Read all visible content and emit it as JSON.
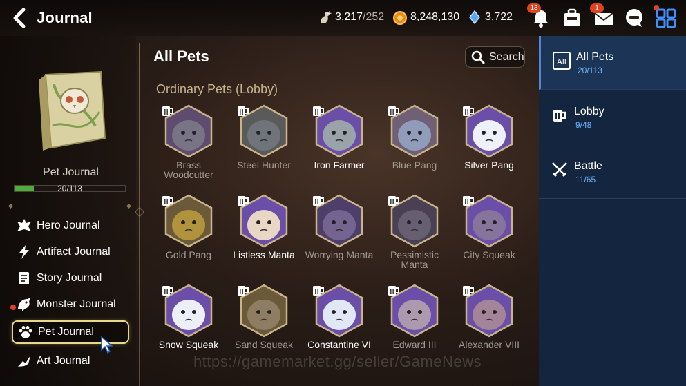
{
  "header": {
    "title": "Journal",
    "resources": [
      {
        "icon": "stamina-icon",
        "value": "3,217",
        "sub": "/252"
      },
      {
        "icon": "gold-icon",
        "value": "8,248,130",
        "sub": ""
      },
      {
        "icon": "crystal-icon",
        "value": "3,722",
        "sub": ""
      }
    ],
    "notification_count": "13",
    "mail_count": "1"
  },
  "left": {
    "journal_title": "Pet Journal",
    "progress_text": "20/113",
    "progress_fraction": 0.177,
    "nav": [
      {
        "label": "Hero Journal",
        "icon": "hero-icon"
      },
      {
        "label": "Artifact Journal",
        "icon": "artifact-icon"
      },
      {
        "label": "Story Journal",
        "icon": "story-icon"
      },
      {
        "label": "Monster Journal",
        "icon": "monster-icon"
      },
      {
        "label": "Pet Journal",
        "icon": "paw-icon"
      },
      {
        "label": "Art Journal",
        "icon": "art-icon"
      }
    ]
  },
  "main": {
    "title": "All Pets",
    "search_label": "Search",
    "section": "Ordinary Pets (Lobby)",
    "pets": [
      {
        "name": "Brass Woodcutter",
        "owned": false,
        "color": "#8a8f96",
        "frame": "#5e4b6e"
      },
      {
        "name": "Steel Hunter",
        "owned": false,
        "color": "#7c8690",
        "frame": "#5a5a5a"
      },
      {
        "name": "Iron Farmer",
        "owned": true,
        "color": "#9aa3aa",
        "frame": "#6b4ea8"
      },
      {
        "name": "Blue Pang",
        "owned": false,
        "color": "#a8c4e8",
        "frame": "#6f6076"
      },
      {
        "name": "Silver Pang",
        "owned": true,
        "color": "#eef1f8",
        "frame": "#6b4ea8"
      },
      {
        "name": "Gold Pang",
        "owned": false,
        "color": "#e0b840",
        "frame": "#6b5a3a"
      },
      {
        "name": "Listless Manta",
        "owned": true,
        "color": "#e8d7c4",
        "frame": "#6b4ea8"
      },
      {
        "name": "Worrying Manta",
        "owned": false,
        "color": "#8f7fa8",
        "frame": "#4e3e6a"
      },
      {
        "name": "Pessimistic Manta",
        "owned": false,
        "color": "#7a7486",
        "frame": "#4a4054"
      },
      {
        "name": "City Squeak",
        "owned": false,
        "color": "#9a8d94",
        "frame": "#6b4ea8"
      },
      {
        "name": "Snow Squeak",
        "owned": true,
        "color": "#eceff6",
        "frame": "#6b4ea8"
      },
      {
        "name": "Sand Squeak",
        "owned": false,
        "color": "#a7957e",
        "frame": "#6b5a3a"
      },
      {
        "name": "Constantine VI",
        "owned": true,
        "color": "#dfe8f4",
        "frame": "#6b4ea8"
      },
      {
        "name": "Edward III",
        "owned": false,
        "color": "#d8cbb0",
        "frame": "#6b4ea8"
      },
      {
        "name": "Alexander VIII",
        "owned": false,
        "color": "#c9a890",
        "frame": "#6b4ea8"
      }
    ]
  },
  "right": {
    "tabs": [
      {
        "label": "All Pets",
        "count": "20/113",
        "icon": "all-icon",
        "icon_text": "All"
      },
      {
        "label": "Lobby",
        "count": "9/48",
        "icon": "mug-icon"
      },
      {
        "label": "Battle",
        "count": "11/65",
        "icon": "crossed-swords-icon"
      }
    ]
  },
  "watermark": "https://gamemarket.gg/seller/GameNews"
}
